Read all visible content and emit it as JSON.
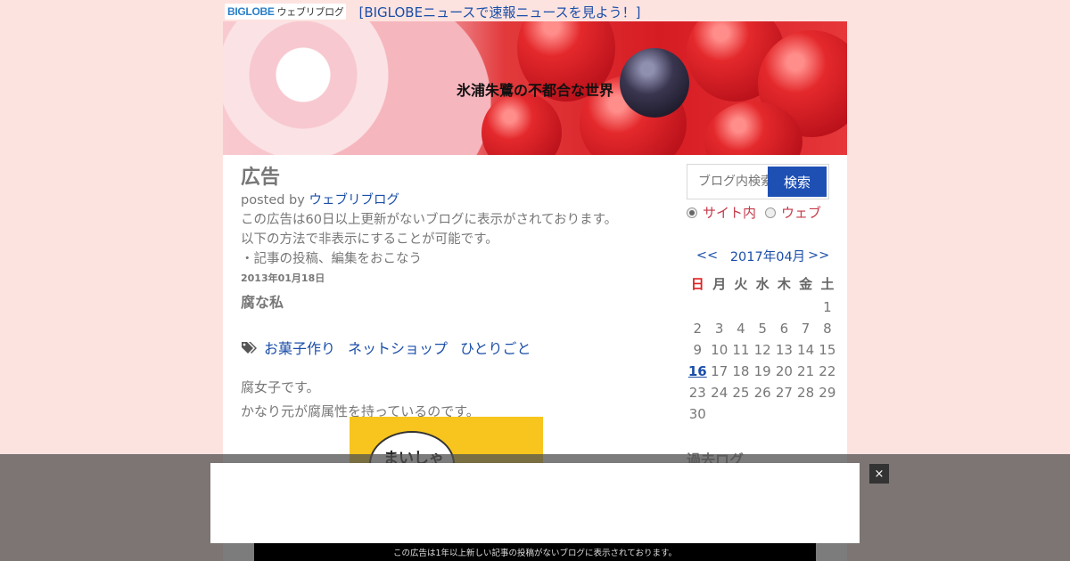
{
  "topbar": {
    "logo_text": "BIGLOBE",
    "logo_sub": "ウェブリブログ",
    "news_link": "[BIGLOBEニュースで速報ニュースを見よう！]"
  },
  "header": {
    "blog_title": "氷浦朱鷺の不都合な世界"
  },
  "ad_notice": {
    "title": "広告",
    "posted_by_prefix": "posted by ",
    "posted_by_name": "ウェブリブログ",
    "lines": [
      "この広告は60日以上更新がないブログに表示がされております。",
      "以下の方法で非表示にすることが可能です。",
      "・記事の投稿、編集をおこなう"
    ]
  },
  "post": {
    "date": "2013年01月18日",
    "title": "腐な私",
    "tags": [
      "お菓子作り",
      "ネットショップ",
      "ひとりごと"
    ],
    "body": [
      "腐女子です。",
      "かなり元が腐属性を持っているのです。"
    ],
    "image_text": "まいしゃ"
  },
  "sidebar": {
    "search": {
      "placeholder": "ブログ内検索",
      "button": "検索",
      "scope_site": "サイト内",
      "scope_web": "ウェブ"
    },
    "calendar": {
      "prev": "<<",
      "month": "2017年04月",
      "next": ">>",
      "weekdays": [
        "日",
        "月",
        "火",
        "水",
        "木",
        "金",
        "土"
      ],
      "weeks": [
        [
          "",
          "",
          "",
          "",
          "",
          "",
          "1"
        ],
        [
          "2",
          "3",
          "4",
          "5",
          "6",
          "7",
          "8"
        ],
        [
          "9",
          "10",
          "11",
          "12",
          "13",
          "14",
          "15"
        ],
        [
          "16",
          "17",
          "18",
          "19",
          "20",
          "21",
          "22"
        ],
        [
          "23",
          "24",
          "25",
          "26",
          "27",
          "28",
          "29"
        ],
        [
          "30",
          "",
          "",
          "",
          "",
          "",
          ""
        ]
      ],
      "linked_day": "16"
    },
    "archive_title": "過去ログ"
  },
  "overlay": {
    "close": "×",
    "notice": "この広告は1年以上新しい記事の投稿がないブログに表示されております。"
  },
  "colors": {
    "background": "#fde3e0",
    "link": "#1a4ea8",
    "search_button": "#1e50b4",
    "sunday": "#dd2222"
  }
}
